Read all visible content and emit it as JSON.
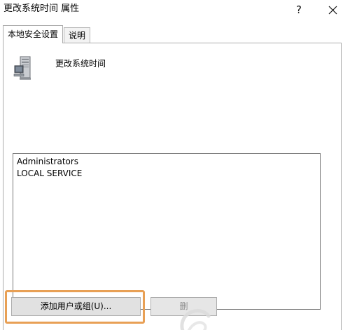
{
  "window": {
    "title": "更改系统时间 属性",
    "help_label": "?"
  },
  "tabs": [
    {
      "label": "本地安全设置",
      "active": true
    },
    {
      "label": "说明",
      "active": false
    }
  ],
  "policy": {
    "icon": "server-computer-icon",
    "name": "更改系统时间"
  },
  "principals": [
    "Administrators",
    "LOCAL SERVICE"
  ],
  "buttons": {
    "add_label": "添加用户或组(U)...",
    "remove_label": "删"
  },
  "colors": {
    "highlight": "#e8a055",
    "button_face": "#e1e1e1",
    "border": "#adadad"
  }
}
